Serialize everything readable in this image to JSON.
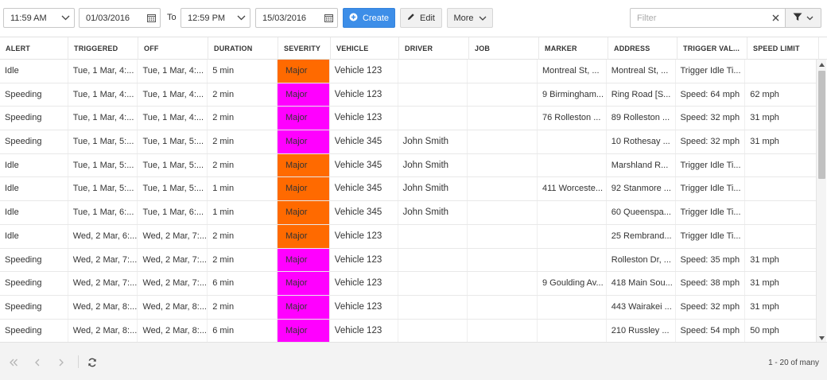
{
  "toolbar": {
    "start_time": "11:59 AM",
    "start_date": "01/03/2016",
    "to_label": "To",
    "end_time": "12:59 PM",
    "end_date": "15/03/2016",
    "create_label": "Create",
    "edit_label": "Edit",
    "more_label": "More",
    "filter_placeholder": "Filter"
  },
  "table": {
    "columns": [
      "ALERT",
      "TRIGGERED",
      "OFF",
      "DURATION",
      "SEVERITY",
      "VEHICLE",
      "DRIVER",
      "JOB",
      "MARKER",
      "ADDRESS",
      "TRIGGER VAL...",
      "SPEED LIMIT"
    ],
    "rows": [
      {
        "alert": "Idle",
        "triggered": "Tue, 1 Mar, 4:...",
        "off": "Tue, 1 Mar, 4:...",
        "duration": "5 min",
        "severity": "Major",
        "severity_color": "#ff6a00",
        "vehicle": "Vehicle 123",
        "driver": "",
        "job": "",
        "marker": "Montreal St, ...",
        "address": "Montreal St, ...",
        "trigger": "Trigger Idle Ti...",
        "speed_limit": ""
      },
      {
        "alert": "Speeding",
        "triggered": "Tue, 1 Mar, 4:...",
        "off": "Tue, 1 Mar, 4:...",
        "duration": "2 min",
        "severity": "Major",
        "severity_color": "#ff00ff",
        "vehicle": "Vehicle 123",
        "driver": "",
        "job": "",
        "marker": "9 Birmingham...",
        "address": "Ring Road [S...",
        "trigger": "Speed: 64 mph",
        "speed_limit": "62 mph"
      },
      {
        "alert": "Speeding",
        "triggered": "Tue, 1 Mar, 4:...",
        "off": "Tue, 1 Mar, 4:...",
        "duration": "2 min",
        "severity": "Major",
        "severity_color": "#ff00ff",
        "vehicle": "Vehicle 123",
        "driver": "",
        "job": "",
        "marker": "76 Rolleston ...",
        "address": "89 Rolleston ...",
        "trigger": "Speed: 32 mph",
        "speed_limit": "31 mph"
      },
      {
        "alert": "Speeding",
        "triggered": "Tue, 1 Mar, 5:...",
        "off": "Tue, 1 Mar, 5:...",
        "duration": "2 min",
        "severity": "Major",
        "severity_color": "#ff00ff",
        "vehicle": "Vehicle 345",
        "driver": "John Smith",
        "job": "",
        "marker": "",
        "address": "10 Rothesay ...",
        "trigger": "Speed: 32 mph",
        "speed_limit": "31 mph"
      },
      {
        "alert": "Idle",
        "triggered": "Tue, 1 Mar, 5:...",
        "off": "Tue, 1 Mar, 5:...",
        "duration": "2 min",
        "severity": "Major",
        "severity_color": "#ff6a00",
        "vehicle": "Vehicle 345",
        "driver": "John Smith",
        "job": "",
        "marker": "",
        "address": "Marshland R...",
        "trigger": "Trigger Idle Ti...",
        "speed_limit": ""
      },
      {
        "alert": "Idle",
        "triggered": "Tue, 1 Mar, 5:...",
        "off": "Tue, 1 Mar, 5:...",
        "duration": "1 min",
        "severity": "Major",
        "severity_color": "#ff6a00",
        "vehicle": "Vehicle 345",
        "driver": "John Smith",
        "job": "",
        "marker": "411 Worceste...",
        "address": "92 Stanmore ...",
        "trigger": "Trigger Idle Ti...",
        "speed_limit": ""
      },
      {
        "alert": "Idle",
        "triggered": "Tue, 1 Mar, 6:...",
        "off": "Tue, 1 Mar, 6:...",
        "duration": "1 min",
        "severity": "Major",
        "severity_color": "#ff6a00",
        "vehicle": "Vehicle 345",
        "driver": "John Smith",
        "job": "",
        "marker": "",
        "address": "60 Queenspa...",
        "trigger": "Trigger Idle Ti...",
        "speed_limit": ""
      },
      {
        "alert": "Idle",
        "triggered": "Wed, 2 Mar, 6:...",
        "off": "Wed, 2 Mar, 7:...",
        "duration": "2 min",
        "severity": "Major",
        "severity_color": "#ff6a00",
        "vehicle": "Vehicle 123",
        "driver": "",
        "job": "",
        "marker": "",
        "address": "25 Rembrand...",
        "trigger": "Trigger Idle Ti...",
        "speed_limit": ""
      },
      {
        "alert": "Speeding",
        "triggered": "Wed, 2 Mar, 7:...",
        "off": "Wed, 2 Mar, 7:...",
        "duration": "2 min",
        "severity": "Major",
        "severity_color": "#ff00ff",
        "vehicle": "Vehicle 123",
        "driver": "",
        "job": "",
        "marker": "",
        "address": "Rolleston Dr, ...",
        "trigger": "Speed: 35 mph",
        "speed_limit": "31 mph"
      },
      {
        "alert": "Speeding",
        "triggered": "Wed, 2 Mar, 7:...",
        "off": "Wed, 2 Mar, 7:...",
        "duration": "6 min",
        "severity": "Major",
        "severity_color": "#ff00ff",
        "vehicle": "Vehicle 123",
        "driver": "",
        "job": "",
        "marker": "9 Goulding Av...",
        "address": "418 Main Sou...",
        "trigger": "Speed: 38 mph",
        "speed_limit": "31 mph"
      },
      {
        "alert": "Speeding",
        "triggered": "Wed, 2 Mar, 8:...",
        "off": "Wed, 2 Mar, 8:...",
        "duration": "2 min",
        "severity": "Major",
        "severity_color": "#ff00ff",
        "vehicle": "Vehicle 123",
        "driver": "",
        "job": "",
        "marker": "",
        "address": "443 Wairakei ...",
        "trigger": "Speed: 32 mph",
        "speed_limit": "31 mph"
      },
      {
        "alert": "Speeding",
        "triggered": "Wed, 2 Mar, 8:...",
        "off": "Wed, 2 Mar, 8:...",
        "duration": "6 min",
        "severity": "Major",
        "severity_color": "#ff00ff",
        "vehicle": "Vehicle 123",
        "driver": "",
        "job": "",
        "marker": "",
        "address": "210 Russley ...",
        "trigger": "Speed: 54 mph",
        "speed_limit": "50 mph"
      }
    ]
  },
  "pager": {
    "info": "1 - 20 of many"
  },
  "colors": {
    "accent": "#3d8ee8",
    "severity_orange": "#ff6a00",
    "severity_magenta": "#ff00ff"
  }
}
